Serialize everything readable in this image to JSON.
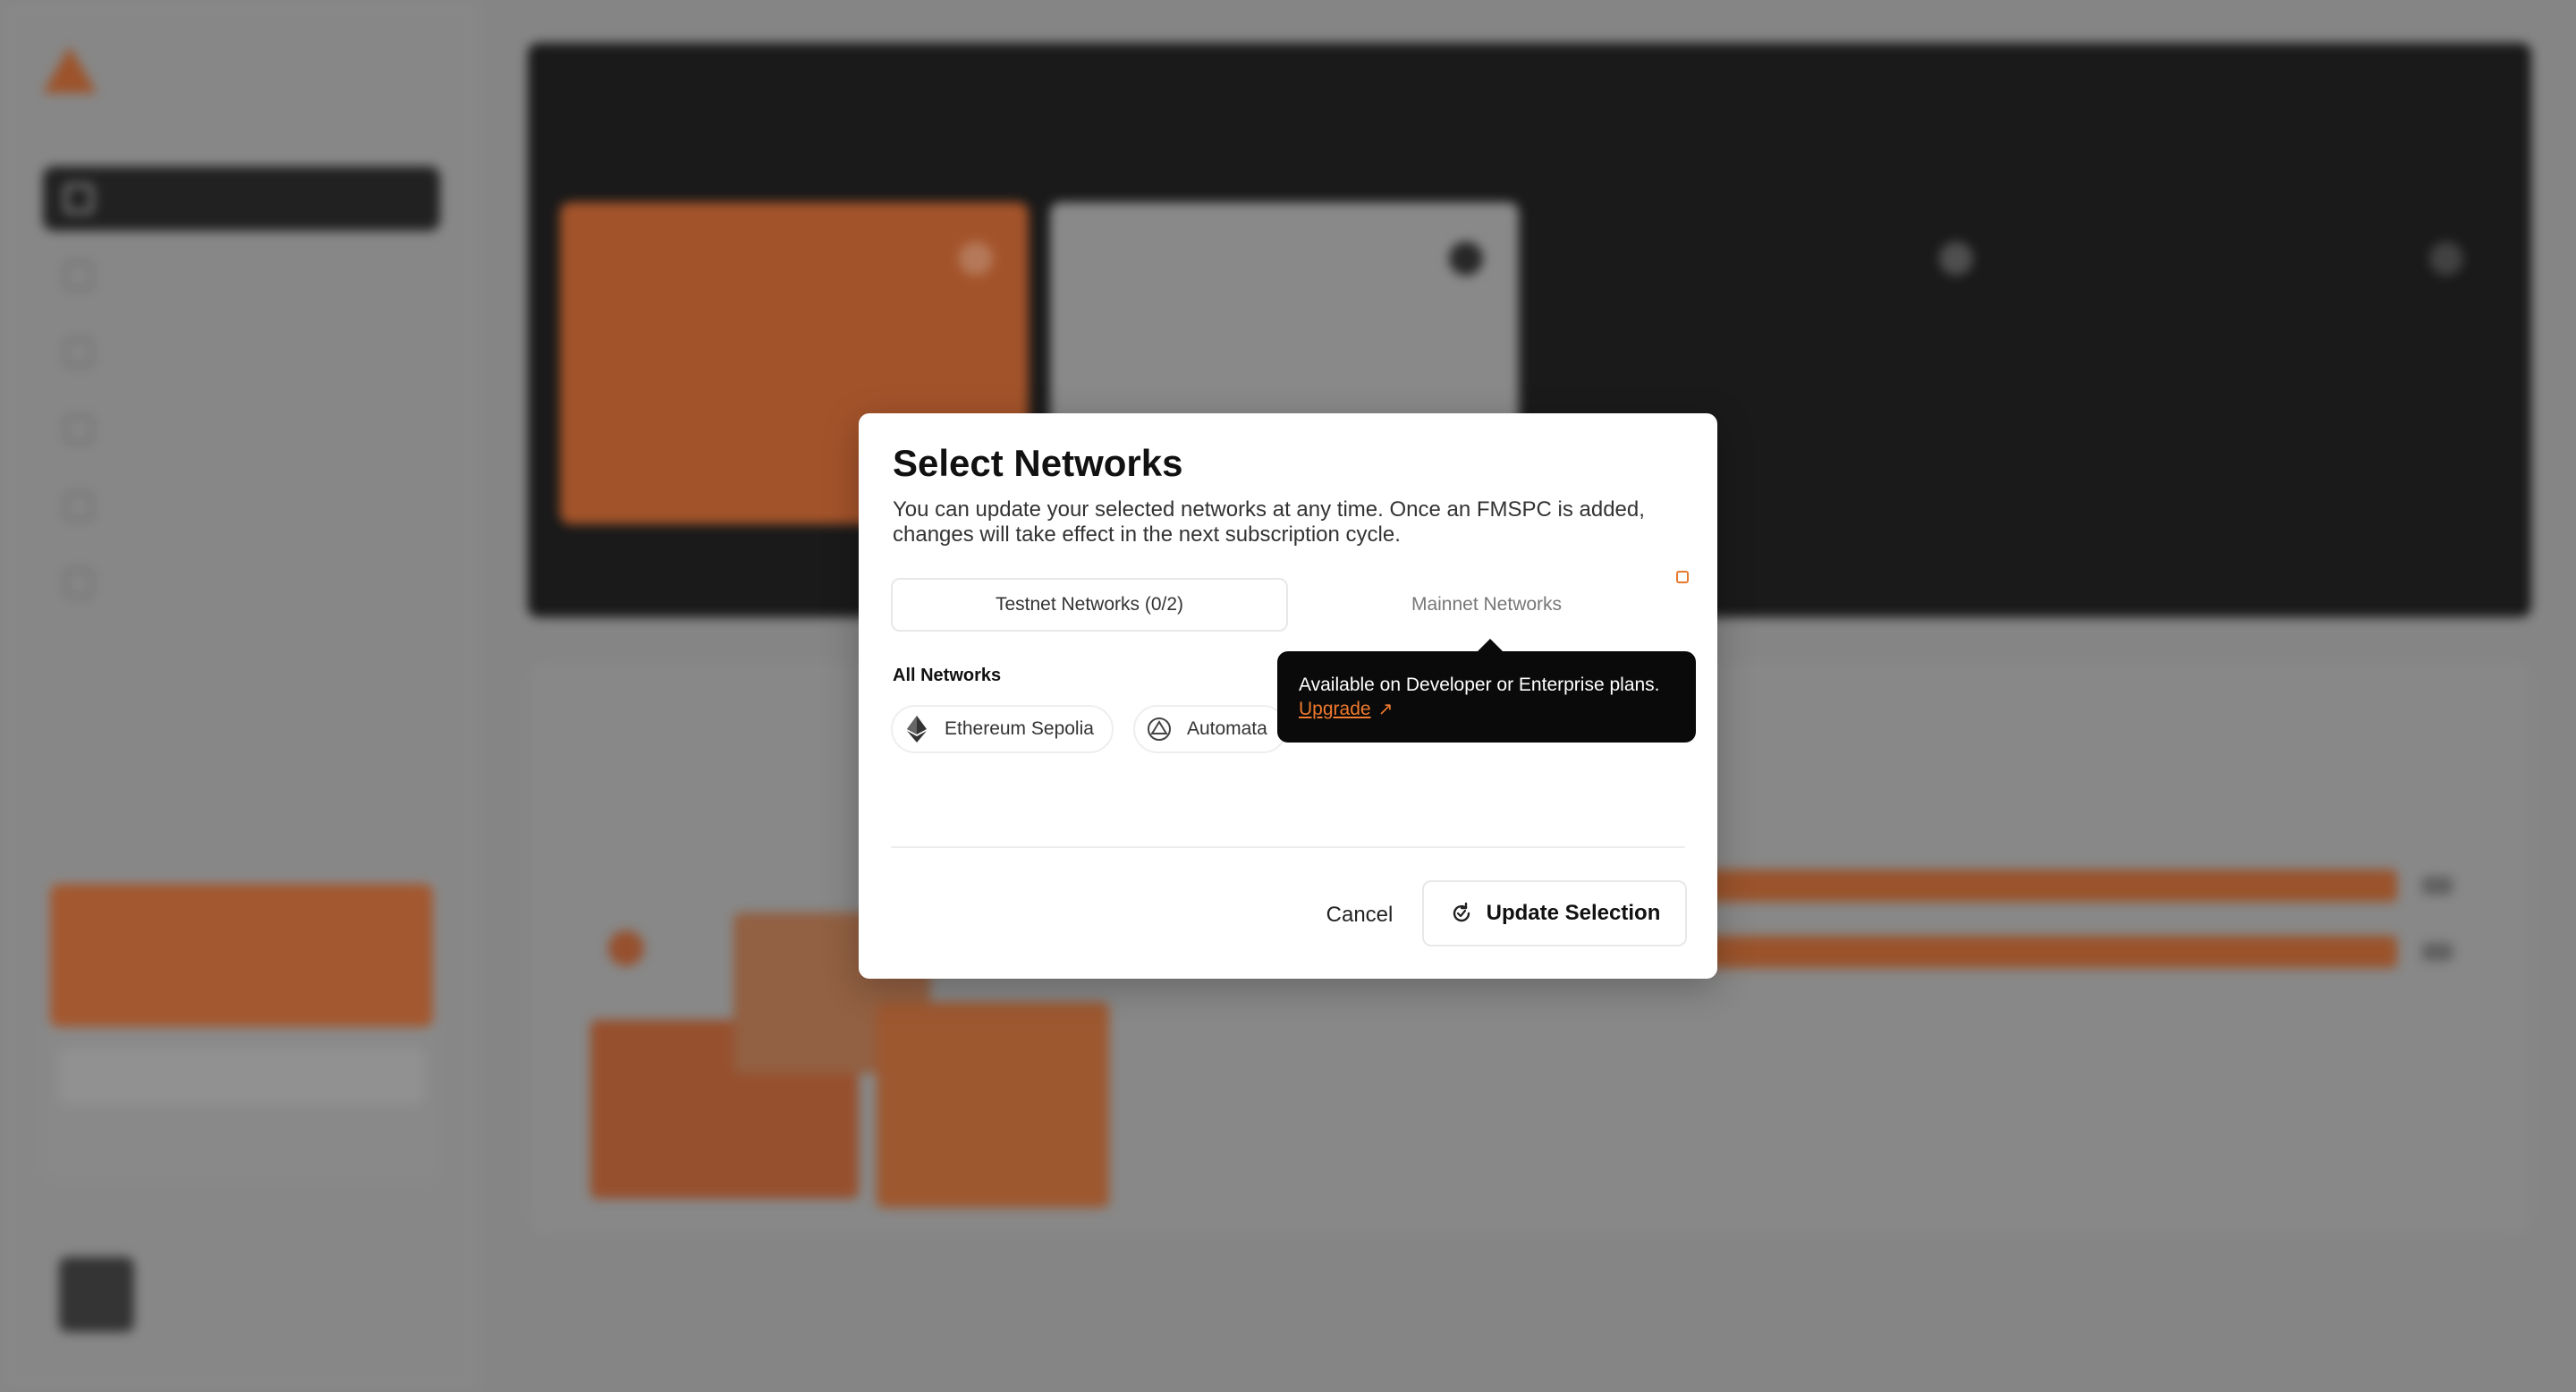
{
  "modal": {
    "title": "Select Networks",
    "description": "You can update your selected networks at any time. Once an FMSPC is added, changes will take effect in the next subscription cycle.",
    "tabs": [
      {
        "label": "Testnet Networks (0/2)",
        "active": true
      },
      {
        "label": "Mainnet Networks",
        "active": false,
        "locked": true
      }
    ],
    "section_label": "All Networks",
    "networks": [
      {
        "label": "Ethereum Sepolia",
        "icon": "ethereum-icon"
      },
      {
        "label": "Automata",
        "icon": "automata-icon"
      }
    ],
    "cancel_label": "Cancel",
    "update_label": "Update Selection"
  },
  "tooltip": {
    "text": "Available on Developer or Enterprise plans.",
    "link_label": "Upgrade",
    "link_icon": "external-arrow-icon"
  },
  "colors": {
    "accent": "#f07a2e",
    "tooltip_bg": "#0a0a0a",
    "modal_bg": "#ffffff"
  }
}
